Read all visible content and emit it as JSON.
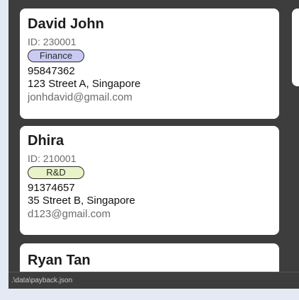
{
  "contacts": [
    {
      "name": "David John",
      "id": "ID: 230001",
      "department": "Finance",
      "department_color": "#c9cbf5",
      "phone": "95847362",
      "address": "123 Street A, Singapore",
      "email": "jonhdavid@gmail.com"
    },
    {
      "name": "Dhira",
      "id": "ID: 210001",
      "department": "R&D",
      "department_color": "#e8f4c7",
      "phone": "91374657",
      "address": "35 Street B, Singapore",
      "email": "d123@gmail.com"
    },
    {
      "name": "Ryan Tan"
    }
  ],
  "status_bar": {
    "file_path": ".\\data\\payback.json"
  },
  "colors": {
    "panel_background": "#3d3d3d",
    "card_background": "#ffffff",
    "page_background": "#e3eaf3"
  }
}
